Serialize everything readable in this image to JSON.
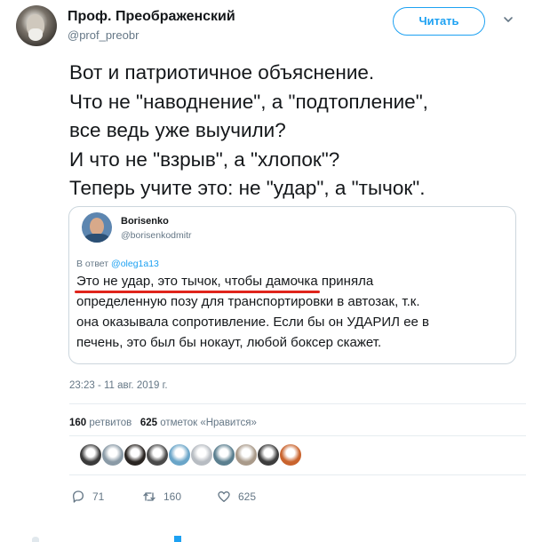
{
  "author": {
    "name": "Проф. Преображенский",
    "handle": "@prof_preobr"
  },
  "follow_label": "Читать",
  "tweet_lines": [
    "Вот и патриотичное объяснение.",
    "Что не \"наводнение\", а \"подтопление\",",
    "все ведь уже выучили?",
    "И что не \"взрыв\", а \"хлопок\"?",
    "Теперь учите это: не \"удар\", а \"тычок\"."
  ],
  "quote": {
    "name": "Borisenko",
    "handle": "@borisenkodmitr",
    "reply_prefix": "В ответ",
    "reply_to": "@oleg1a13",
    "lines": [
      "Это не удар, это тычок, чтобы дамочка приняла",
      "определенную позу для транспортировки в автозак, т.к.",
      "она  оказывала сопротивление. Если бы он УДАРИЛ ее в",
      "печень, это был бы нокаут, любой боксер скажет."
    ],
    "underline_color": "#e0241b"
  },
  "timestamp": "23:23 - 11 авг. 2019 г.",
  "stats": {
    "retweets_count": "160",
    "retweets_label": "ретвитов",
    "likes_count": "625",
    "likes_label": "отметок «Нравится»"
  },
  "likers": [
    {
      "icon": "liker-avatar",
      "color": "#3a3a3a"
    },
    {
      "icon": "liker-avatar",
      "color": "#8a9aa6"
    },
    {
      "icon": "liker-avatar",
      "color": "#2a2522"
    },
    {
      "icon": "liker-avatar",
      "color": "#4a4a4a"
    },
    {
      "icon": "liker-avatar",
      "color": "#6aa5c8"
    },
    {
      "icon": "liker-avatar",
      "color": "#b7bcc2"
    },
    {
      "icon": "liker-avatar",
      "color": "#5b7f8f"
    },
    {
      "icon": "liker-avatar",
      "color": "#a99a8a"
    },
    {
      "icon": "liker-avatar",
      "color": "#3d3d3d"
    },
    {
      "icon": "liker-avatar",
      "color": "#c9632d"
    }
  ],
  "actions": {
    "reply_count": "71",
    "retweet_count": "160",
    "like_count": "625"
  },
  "colors": {
    "accent": "#1da1f2",
    "secondary_text": "#657786",
    "border": "#ccd6dd"
  }
}
